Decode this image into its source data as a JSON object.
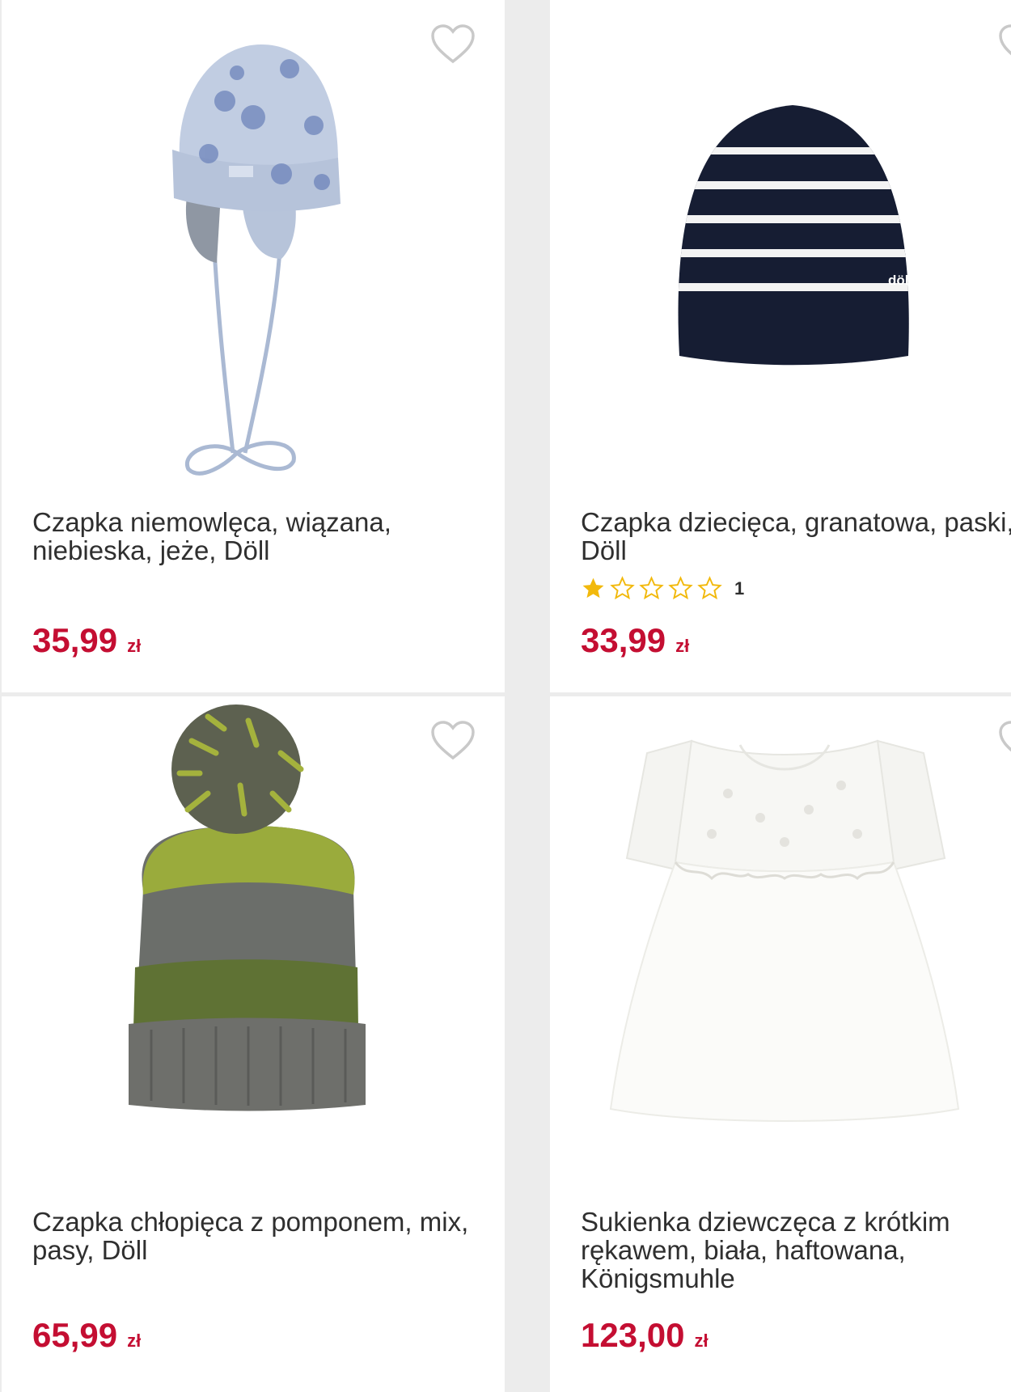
{
  "colors": {
    "price": "#c40e32",
    "title": "#2f2f2f",
    "star_filled": "#f2b90c",
    "background": "#ececec"
  },
  "products": [
    {
      "name": "Czapka niemowlęca, wiązana, niebieska, jeże, Döll",
      "price": "35,99",
      "currency": "zł",
      "image_icon": "baby-hat-image"
    },
    {
      "name": "Czapka dziecięca, granatowa, paski, Döll",
      "price": "33,99",
      "currency": "zł",
      "rating": {
        "stars": 1,
        "max": 5,
        "count": "1"
      },
      "image_icon": "striped-beanie-image",
      "label_brand": "döll"
    },
    {
      "name": "Czapka chłopięca z pomponem, mix, pasy, Döll",
      "price": "65,99",
      "currency": "zł",
      "image_icon": "pompom-hat-image"
    },
    {
      "name": "Sukienka dziewczęca z krótkim rękawem, biała, haftowana, Königsmuhle",
      "price": "123,00",
      "currency": "zł",
      "image_icon": "white-dress-image"
    }
  ]
}
